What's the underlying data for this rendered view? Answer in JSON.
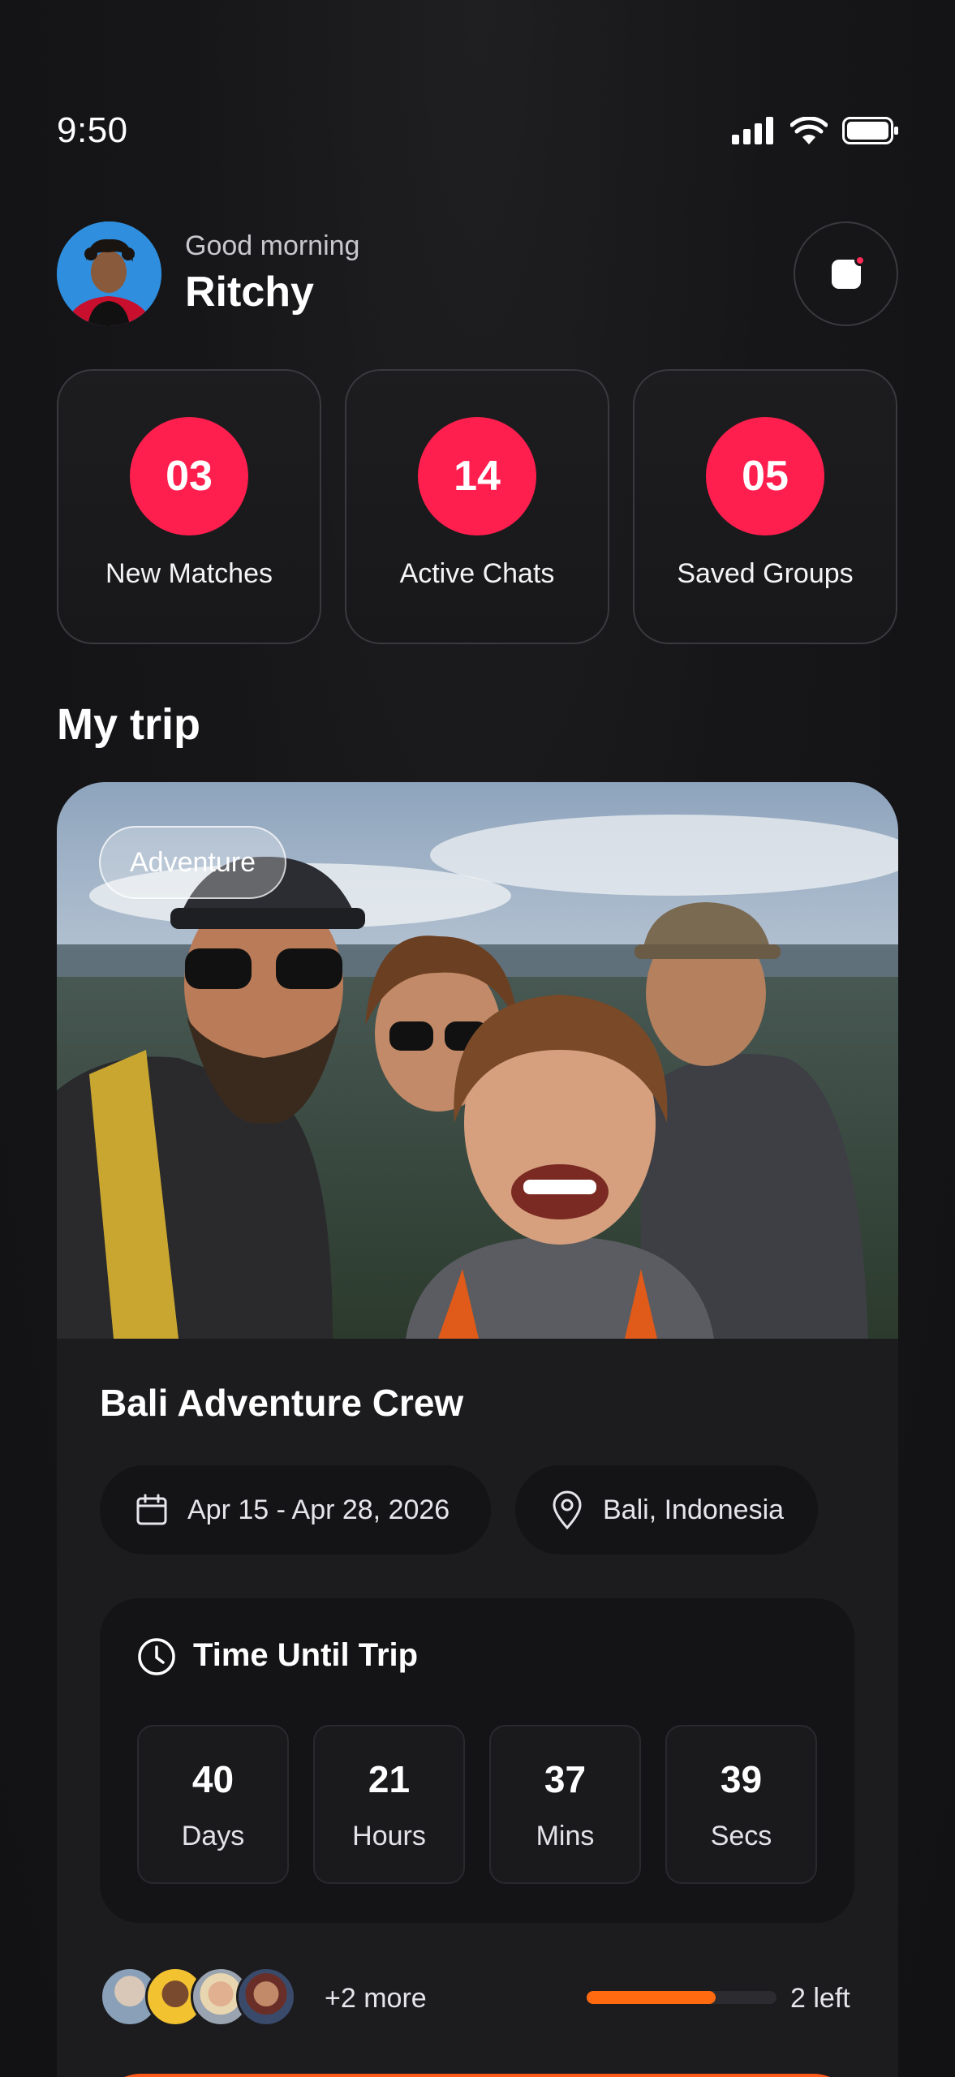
{
  "status_bar": {
    "time": "9:50"
  },
  "header": {
    "greeting": "Good morning",
    "user_name": "Ritchy"
  },
  "stats": [
    {
      "value": "03",
      "label": "New Matches"
    },
    {
      "value": "14",
      "label": "Active Chats"
    },
    {
      "value": "05",
      "label": "Saved Groups"
    }
  ],
  "my_trip": {
    "section_title": "My trip",
    "tag": "Adventure",
    "name": "Bali Adventure Crew",
    "dates": "Apr 15 - Apr 28, 2026",
    "location": "Bali, Indonesia",
    "countdown": {
      "title": "Time Until Trip",
      "units": [
        {
          "value": "40",
          "label": "Days"
        },
        {
          "value": "21",
          "label": "Hours"
        },
        {
          "value": "37",
          "label": "Mins"
        },
        {
          "value": "39",
          "label": "Secs"
        }
      ]
    },
    "members_more": "+2 more",
    "spots_filled_fraction": 0.68,
    "spots_left": "2 left"
  },
  "colors": {
    "accent": "#ff1f4f",
    "progress": "#ff6a10",
    "background": "#151517"
  }
}
